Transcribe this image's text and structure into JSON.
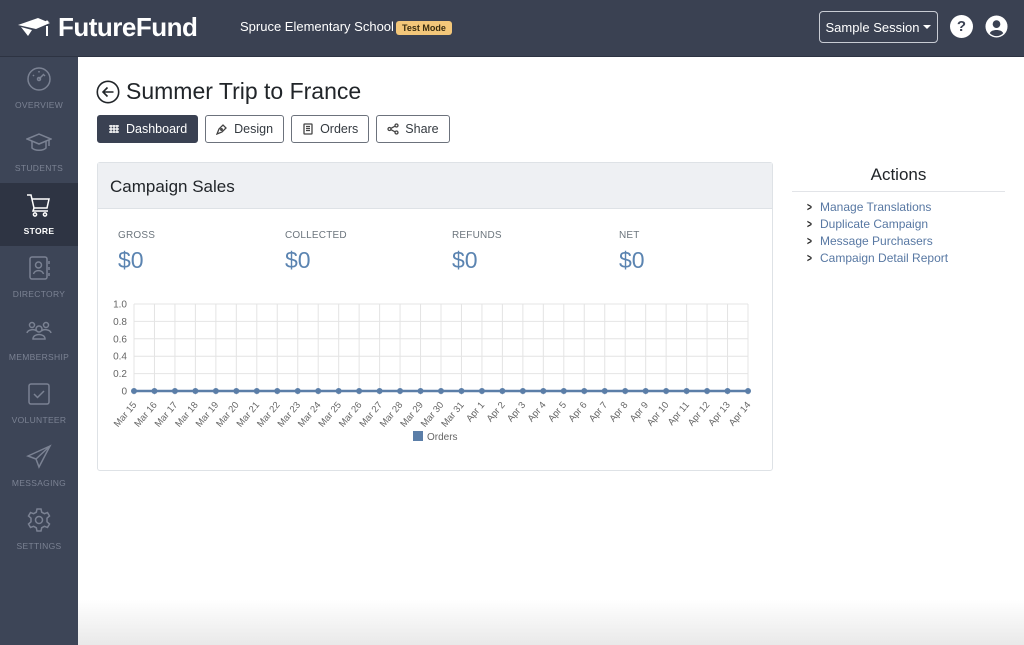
{
  "header": {
    "brand": "FutureFund",
    "school": "Spruce Elementary School",
    "mode_badge": "Test Mode",
    "session_button": "Sample Session",
    "help_label": "?"
  },
  "sidebar": {
    "items": [
      {
        "label": "OVERVIEW",
        "icon": "gauge-icon",
        "active": false
      },
      {
        "label": "STUDENTS",
        "icon": "graduation-cap-icon",
        "active": false
      },
      {
        "label": "STORE",
        "icon": "cart-icon",
        "active": true
      },
      {
        "label": "DIRECTORY",
        "icon": "contact-book-icon",
        "active": false
      },
      {
        "label": "MEMBERSHIP",
        "icon": "group-icon",
        "active": false
      },
      {
        "label": "VOLUNTEER",
        "icon": "checkbox-icon",
        "active": false
      },
      {
        "label": "MESSAGING",
        "icon": "paper-plane-icon",
        "active": false
      },
      {
        "label": "SETTINGS",
        "icon": "gear-icon",
        "active": false
      }
    ]
  },
  "page": {
    "title": "Summer Trip to France",
    "tabs": [
      {
        "label": "Dashboard",
        "active": true
      },
      {
        "label": "Design",
        "active": false
      },
      {
        "label": "Orders",
        "active": false
      },
      {
        "label": "Share",
        "active": false
      }
    ]
  },
  "campaign_sales": {
    "title": "Campaign Sales",
    "stats": [
      {
        "label": "GROSS",
        "value": "$0"
      },
      {
        "label": "COLLECTED",
        "value": "$0"
      },
      {
        "label": "REFUNDS",
        "value": "$0"
      },
      {
        "label": "NET",
        "value": "$0"
      }
    ]
  },
  "chart_data": {
    "type": "line",
    "title": "",
    "xlabel": "",
    "ylabel": "",
    "ylim": [
      0,
      1.0
    ],
    "yticks": [
      "0",
      "0.2",
      "0.4",
      "0.6",
      "0.8",
      "1.0"
    ],
    "grid": true,
    "legend_position": "bottom",
    "color": "#5b7ea8",
    "categories": [
      "Mar 15",
      "Mar 16",
      "Mar 17",
      "Mar 18",
      "Mar 19",
      "Mar 20",
      "Mar 21",
      "Mar 22",
      "Mar 23",
      "Mar 24",
      "Mar 25",
      "Mar 26",
      "Mar 27",
      "Mar 28",
      "Mar 29",
      "Mar 30",
      "Mar 31",
      "Apr 1",
      "Apr 2",
      "Apr 3",
      "Apr 4",
      "Apr 5",
      "Apr 6",
      "Apr 7",
      "Apr 8",
      "Apr 9",
      "Apr 10",
      "Apr 11",
      "Apr 12",
      "Apr 13",
      "Apr 14"
    ],
    "series": [
      {
        "name": "Orders",
        "values": [
          0,
          0,
          0,
          0,
          0,
          0,
          0,
          0,
          0,
          0,
          0,
          0,
          0,
          0,
          0,
          0,
          0,
          0,
          0,
          0,
          0,
          0,
          0,
          0,
          0,
          0,
          0,
          0,
          0,
          0,
          0
        ]
      }
    ]
  },
  "actions": {
    "title": "Actions",
    "items": [
      "Manage Translations",
      "Duplicate Campaign",
      "Message Purchasers",
      "Campaign Detail Report"
    ]
  }
}
